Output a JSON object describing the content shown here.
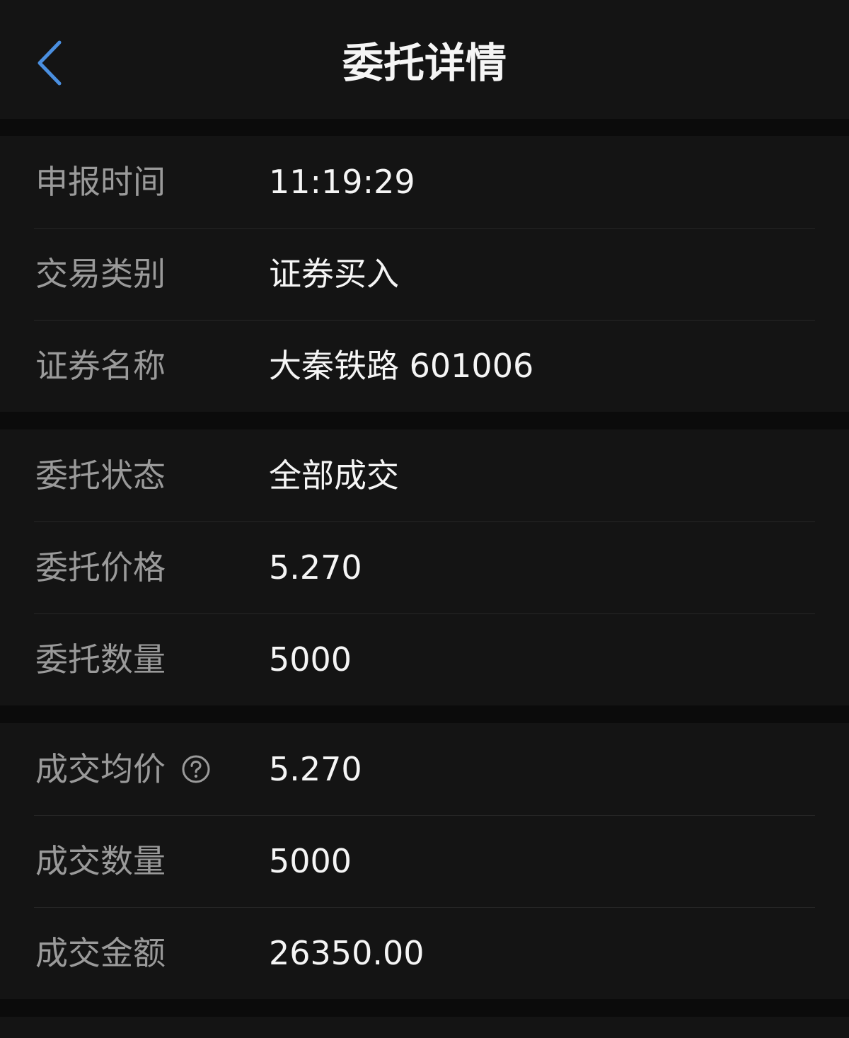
{
  "header": {
    "title": "委托详情",
    "back_icon": "chevron-left-icon",
    "accent_color": "#4a8fe0"
  },
  "section1": {
    "rows": [
      {
        "label": "申报时间",
        "value": "11:19:29"
      },
      {
        "label": "交易类别",
        "value": "证券买入"
      },
      {
        "label": "证券名称",
        "value": "大秦铁路 601006"
      }
    ]
  },
  "section2": {
    "rows": [
      {
        "label": "委托状态",
        "value": "全部成交"
      },
      {
        "label": "委托价格",
        "value": "5.270"
      },
      {
        "label": "委托数量",
        "value": "5000"
      }
    ]
  },
  "section3": {
    "rows": [
      {
        "label": "成交均价",
        "value": "5.270",
        "icon": "help-circle-icon"
      },
      {
        "label": "成交数量",
        "value": "5000"
      },
      {
        "label": "成交金额",
        "value": "26350.00"
      }
    ]
  }
}
